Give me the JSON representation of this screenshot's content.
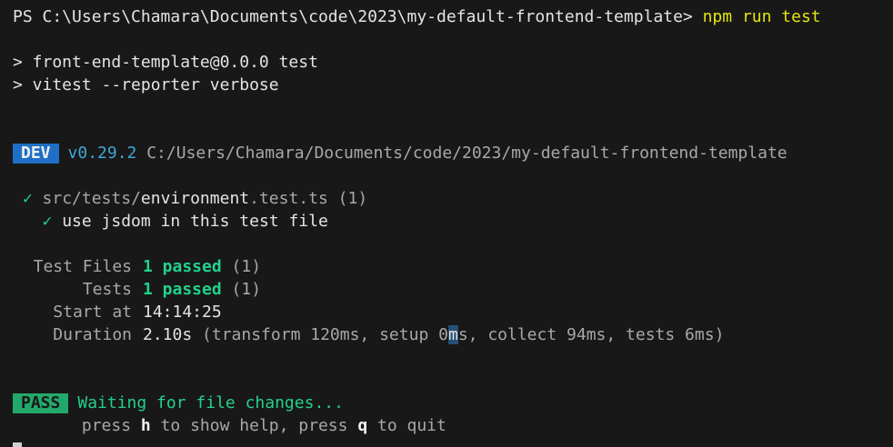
{
  "prompt": {
    "ps_path": "PS C:\\Users\\Chamara\\Documents\\code\\2023\\my-default-frontend-template>",
    "command": "npm run test"
  },
  "npm_output": {
    "line1": "> front-end-template@0.0.0 test",
    "line2": "> vitest --reporter verbose"
  },
  "dev_header": {
    "badge": "DEV",
    "version": "v0.29.2",
    "path": "C:/Users/Chamara/Documents/code/2023/my-default-frontend-template"
  },
  "test_file": {
    "check": "✓",
    "dir": "src/tests/",
    "name": "environment",
    "ext": ".test.ts",
    "count": "(1)",
    "test_check": "✓",
    "test_name": "use jsdom in this test file"
  },
  "summary": {
    "test_files_label": "Test Files",
    "test_files_passed": "1 passed",
    "test_files_count": "(1)",
    "tests_label": "Tests",
    "tests_passed": "1 passed",
    "tests_count": "(1)",
    "start_label": "Start at",
    "start_value": "14:14:25",
    "duration_label": "Duration",
    "duration_value": "2.10s",
    "duration_detail_a": "(transform 120ms, setup 0",
    "duration_detail_sel": "m",
    "duration_detail_b": "s, collect 94ms, tests 6ms)"
  },
  "status": {
    "badge": "PASS",
    "message": "Waiting for file changes...",
    "help_press1": "press ",
    "help_key1": "h",
    "help_mid": " to show help, press ",
    "help_key2": "q",
    "help_end": " to quit"
  },
  "colors": {
    "background": "#181818",
    "dev_badge": "#1f6fc5",
    "pass_badge": "#23a86b",
    "success": "#23d18b",
    "command": "#e5e510",
    "version": "#3fa7d6"
  }
}
